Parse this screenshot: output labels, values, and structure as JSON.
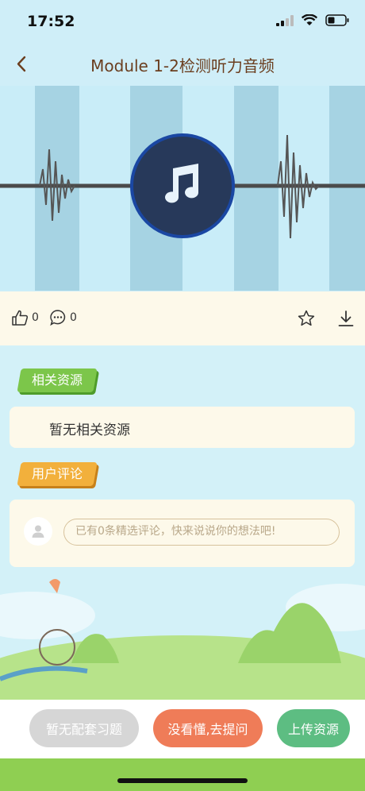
{
  "status_bar": {
    "time": "17:52"
  },
  "nav": {
    "title": "Module 1-2检测听力音频"
  },
  "actions": {
    "like_count": "0",
    "comment_count": "0"
  },
  "related": {
    "tag": "相关资源",
    "empty_text": "暂无相关资源"
  },
  "comments": {
    "tag": "用户评论",
    "placeholder": "已有0条精选评论，快来说说你的想法吧!"
  },
  "bottom": {
    "no_exercise": "暂无配套习题",
    "ask": "没看懂,去提问",
    "upload": "上传资源"
  },
  "colors": {
    "title": "#6b3e1f",
    "disabled_button": "#d6d6d6",
    "ask_button": "#ef7c58",
    "upload_button": "#5dbd82",
    "related_tag": "#7cc64a",
    "comment_tag": "#f2b03c"
  }
}
